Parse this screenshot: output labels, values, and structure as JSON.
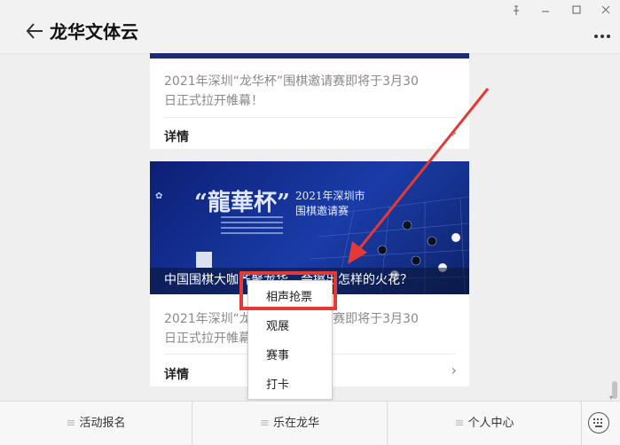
{
  "header": {
    "title": "龙华文体云"
  },
  "articles": [
    {
      "desc_line1": "2021年深圳“龙华杯”围棋邀请赛即将于3月30",
      "desc_line2": "日正式拉开帷幕！",
      "detail_label": "详情"
    },
    {
      "banner": {
        "logo_title": "“龍華杯”",
        "logo_year": "2021年深圳市",
        "logo_sub": "围棋邀请赛",
        "caption": "中国围棋大咖齐聚龙华，会擦出怎样的火花？"
      },
      "desc_line1": "2021年深圳“龙华杯”围棋邀请赛即将于3月30",
      "desc_line2": "日正式拉开帷幕！",
      "detail_label": "详情"
    }
  ],
  "popup_menu": {
    "items": [
      "相声抢票",
      "观展",
      "赛事",
      "打卡"
    ],
    "highlighted_index": 0
  },
  "bottom_tabs": [
    "活动报名",
    "乐在龙华",
    "个人中心"
  ],
  "colors": {
    "annotation": "#e53935",
    "banner": "#1a3ca8"
  }
}
